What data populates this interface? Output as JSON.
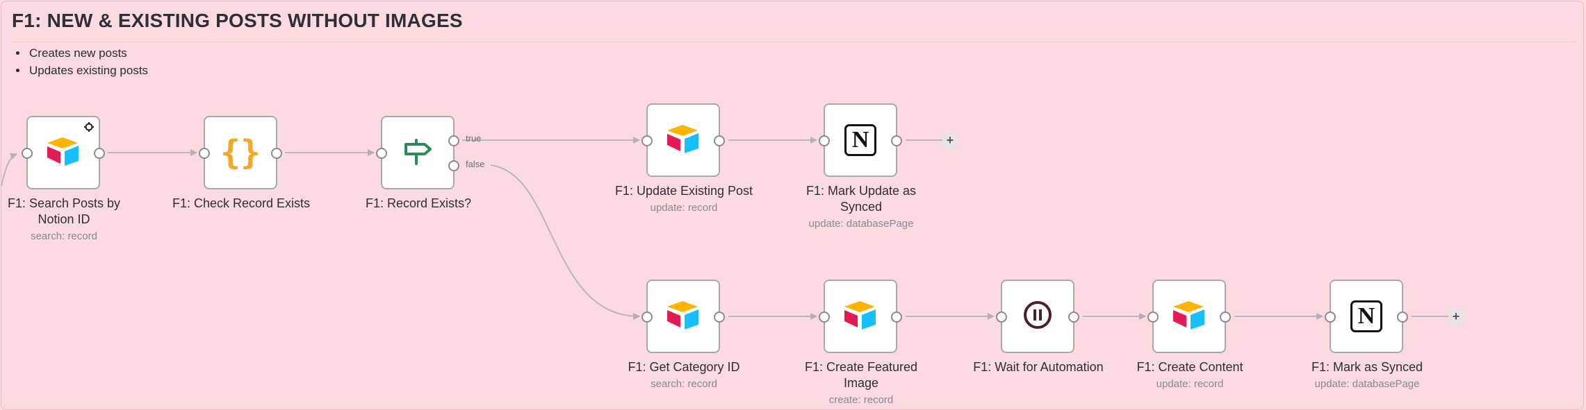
{
  "sticky": {
    "title": "F1: NEW & EXISTING POSTS WITHOUT IMAGES",
    "bullets": [
      "Creates new posts",
      "Updates existing posts"
    ]
  },
  "nodes": [
    {
      "id": "search",
      "label_line1": "F1: Search Posts by",
      "label_line2": "Notion ID",
      "subtitle": "search: record",
      "icon": "airtable-icon"
    },
    {
      "id": "code",
      "label_line1": "F1: Check Record Exists",
      "icon": "code-braces-icon"
    },
    {
      "id": "if",
      "label_line1": "F1: Record Exists?",
      "icon": "signpost-icon",
      "port_true": "true",
      "port_false": "false"
    },
    {
      "id": "update_post",
      "label_line1": "F1: Update Existing Post",
      "subtitle": "update: record",
      "icon": "airtable-icon"
    },
    {
      "id": "mark_update",
      "label_line1": "F1: Mark Update as",
      "label_line2": "Synced",
      "subtitle": "update: databasePage",
      "icon": "notion-icon"
    },
    {
      "id": "get_category",
      "label_line1": "F1: Get Category ID",
      "subtitle": "search: record",
      "icon": "airtable-icon"
    },
    {
      "id": "create_image",
      "label_line1": "F1: Create Featured",
      "label_line2": "Image",
      "subtitle": "create: record",
      "icon": "airtable-icon"
    },
    {
      "id": "wait",
      "label_line1": "F1: Wait for Automation",
      "icon": "pause-icon"
    },
    {
      "id": "create_content",
      "label_line1": "F1: Create Content",
      "subtitle": "update: record",
      "icon": "airtable-icon"
    },
    {
      "id": "mark_synced",
      "label_line1": "F1: Mark as Synced",
      "subtitle": "update: databasePage",
      "icon": "notion-icon"
    }
  ],
  "add_button_symbol": "+",
  "colors": {
    "sticky_bg": "#fcdbe0",
    "node_border": "#a9a7ae",
    "wire": "#b9b7be",
    "airtable_yellow": "#fcb400",
    "airtable_red": "#e31b54",
    "airtable_blue": "#18bfff",
    "code_orange": "#f5a623",
    "if_green": "#2a8c54",
    "wait_maroon": "#4a1f2a"
  }
}
